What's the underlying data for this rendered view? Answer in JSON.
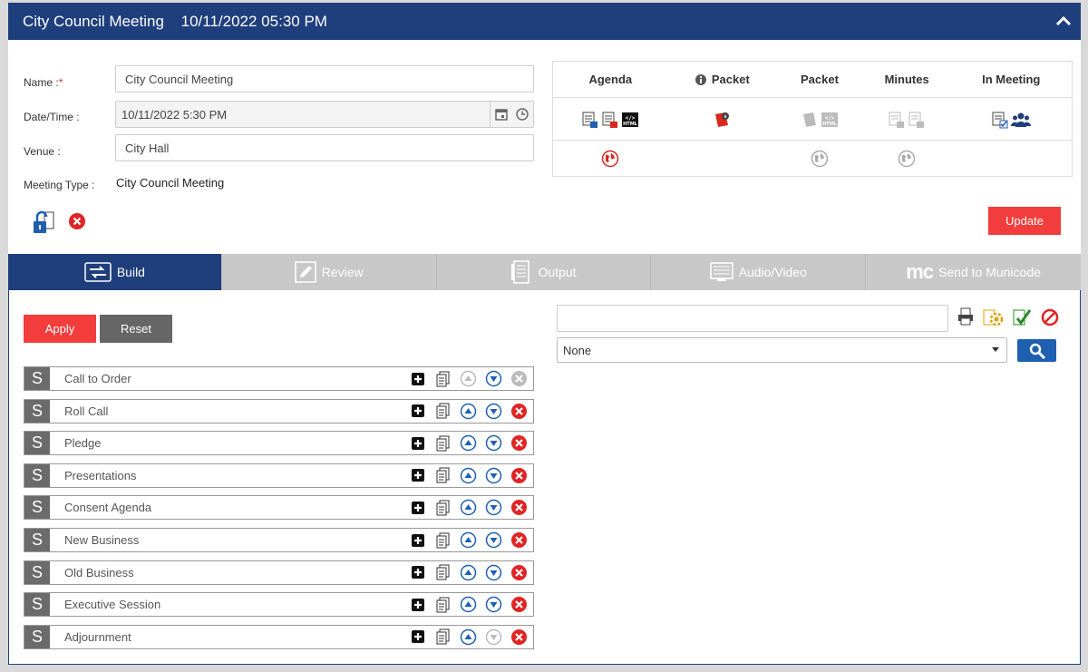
{
  "header": {
    "title": "City Council Meeting",
    "datetime": "10/11/2022 05:30 PM"
  },
  "form": {
    "name_label": "Name :",
    "required_mark": "*",
    "name_value": "City Council Meeting",
    "datetime_label": "Date/Time :",
    "datetime_value": "10/11/2022 5:30 PM",
    "venue_label": "Venue :",
    "venue_value": "City Hall",
    "meeting_type_label": "Meeting Type :",
    "meeting_type_value": "City Council Meeting"
  },
  "docs": {
    "headers": [
      "Agenda",
      "Packet",
      "Packet",
      "Minutes",
      "In Meeting"
    ]
  },
  "update_label": "Update",
  "tabs": [
    {
      "label": "Build",
      "icon": "build-icon"
    },
    {
      "label": "Review",
      "icon": "pencil-icon"
    },
    {
      "label": "Output",
      "icon": "output-icon"
    },
    {
      "label": "Audio/Video",
      "icon": "video-icon"
    },
    {
      "label": "Send to Municode",
      "icon": "municode-logo",
      "logo_text": "mc"
    }
  ],
  "build": {
    "apply_label": "Apply",
    "reset_label": "Reset",
    "section_badge": "S",
    "sections": [
      "Call to Order",
      "Roll Call",
      "Pledge",
      "Presentations",
      "Consent Agenda",
      "New Business",
      "Old Business",
      "Executive Session",
      "Adjournment"
    ]
  },
  "right": {
    "search_value": "",
    "select_value": "None"
  },
  "colors": {
    "primary": "#1f3e7c",
    "accent": "#f33c3c",
    "gray": "#666666"
  }
}
